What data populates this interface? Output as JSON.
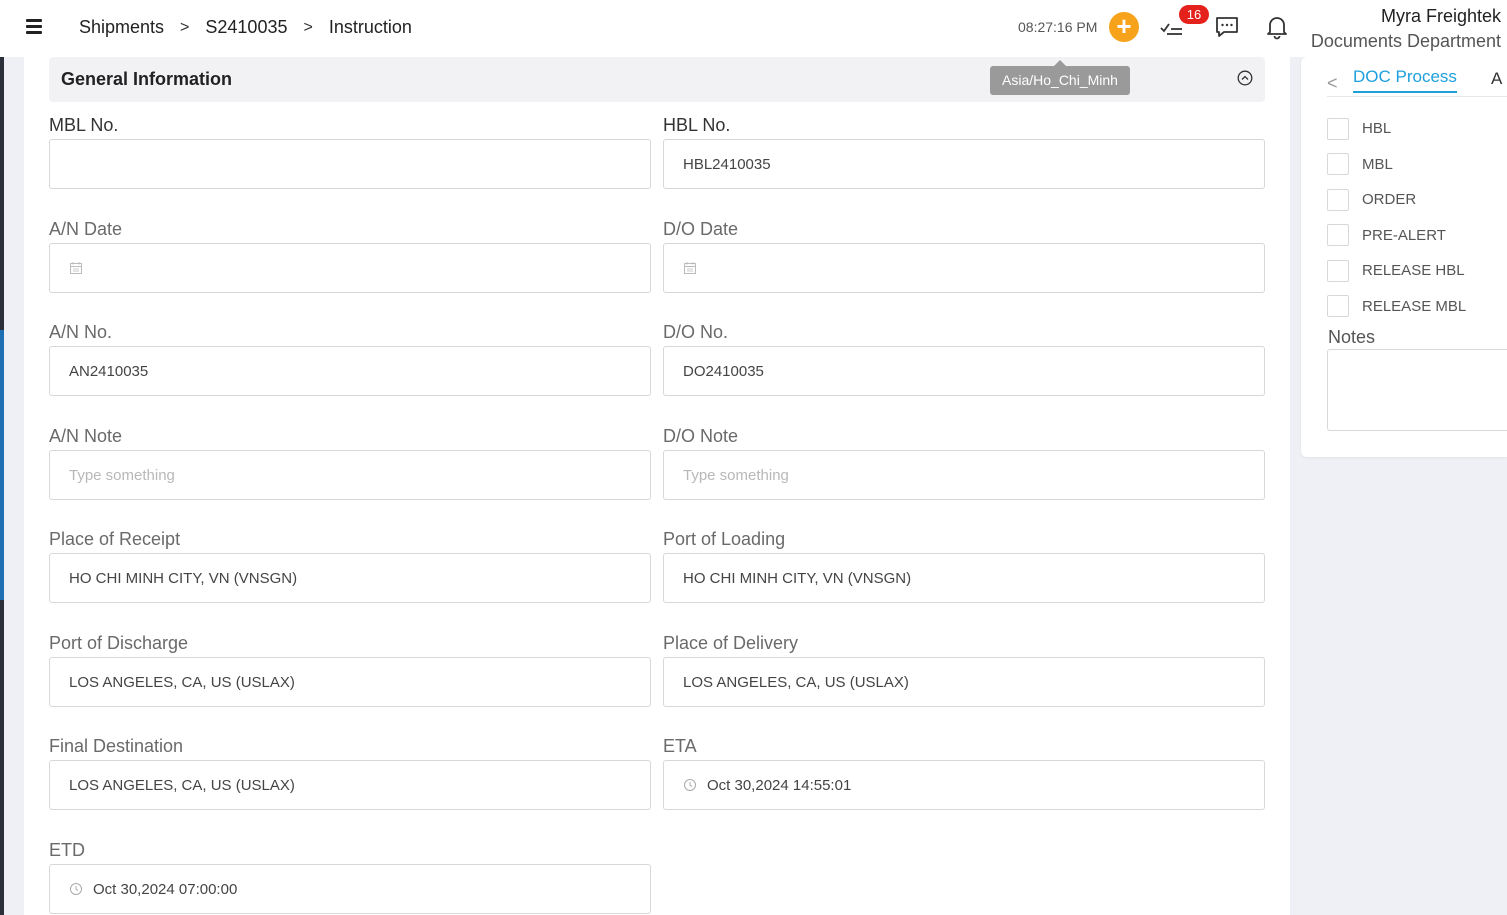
{
  "header": {
    "breadcrumb": [
      "Shipments",
      "S2410035",
      "Instruction"
    ],
    "separator": ">",
    "clock": "08:27:16 PM",
    "add_label": "+",
    "task_badge": "16",
    "user_name": "Myra Freightek",
    "user_department": "Documents Department",
    "timezone_tooltip": "Asia/Ho_Chi_Minh"
  },
  "section": {
    "title": "General Information"
  },
  "form": {
    "mbl_no": {
      "label": "MBL No.",
      "value": ""
    },
    "hbl_no": {
      "label": "HBL No.",
      "value": "HBL2410035"
    },
    "an_date": {
      "label": "A/N Date",
      "value": ""
    },
    "do_date": {
      "label": "D/O Date",
      "value": ""
    },
    "an_no": {
      "label": "A/N No.",
      "value": "AN2410035"
    },
    "do_no": {
      "label": "D/O No.",
      "value": "DO2410035"
    },
    "an_note": {
      "label": "A/N Note",
      "placeholder": "Type something"
    },
    "do_note": {
      "label": "D/O Note",
      "placeholder": "Type something"
    },
    "place_of_receipt": {
      "label": "Place of Receipt",
      "value": "HO CHI MINH CITY, VN (VNSGN)"
    },
    "port_of_loading": {
      "label": "Port of Loading",
      "value": "HO CHI MINH CITY, VN (VNSGN)"
    },
    "port_of_discharge": {
      "label": "Port of Discharge",
      "value": "LOS ANGELES, CA, US (USLAX)"
    },
    "place_of_delivery": {
      "label": "Place of Delivery",
      "value": "LOS ANGELES, CA, US (USLAX)"
    },
    "final_destination": {
      "label": "Final Destination",
      "value": "LOS ANGELES, CA, US (USLAX)"
    },
    "eta": {
      "label": "ETA",
      "value": "Oct 30,2024 14:55:01"
    },
    "etd": {
      "label": "ETD",
      "value": "Oct 30,2024 07:00:00"
    }
  },
  "right_panel": {
    "tab_prev": "<",
    "active_tab": "DOC Process",
    "next_tab_partial": "A",
    "doc_items": [
      "HBL",
      "MBL",
      "ORDER",
      "PRE-ALERT",
      "RELEASE HBL",
      "RELEASE MBL"
    ],
    "notes_label": "Notes"
  },
  "colors": {
    "accent": "#1ea0dc",
    "add_button": "#f7a21b",
    "badge": "#e5211b"
  }
}
